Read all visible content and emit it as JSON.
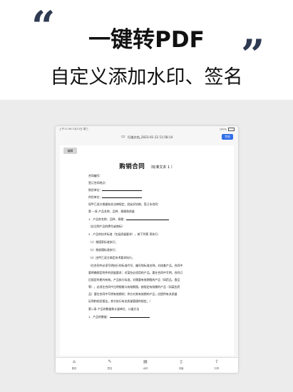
{
  "hero": {
    "quote_open": "“",
    "quote_close": "”",
    "headline": "一键转PDF",
    "subhead": "自定义添加水印、签名"
  },
  "tablet": {
    "status_time": "上午11:56  1月12日 周三",
    "status_battery": "100%",
    "doc_title": "扫描文档_2022-01-12 11:58:14",
    "done_label": "完成"
  },
  "paper": {
    "tag": "编辑",
    "title": "购销合同",
    "subtitle": "（标准文本 1 ）",
    "lines": [
      "合同编号：",
      "签订合同地点：",
      "购货单位：",
      "供货单位：",
      "现甲乙双方根据有关法律规定，经友好协商，签订本合同：",
      "第    一条    产品名称、品种、规格和质量",
      "1．产品的名称、品种、规格：",
      "（应注明产品的牌号或商标）",
      "2．产品的技术标准（包括质量要求），按下列第      项执行：",
      "（1）按国家标准执行；",
      "（2）按部颁标准执行；",
      "（3）由甲乙双方商定技术要求执行。",
      "（在合同中必须写明执行的标准代号、编号和标准名称。对成套产品，合同中",
      "要明确规定附件的质量要求；对某些必须用的产品，要在合同中写明，合同订",
      "后规定时期内有效。产品执行标准，对需要有效期限的产品（如药品、食品",
      "等），必须在合同中注明规格与有效期限，按规定有效期的产品（如某些药",
      "品）要在合同中写明有效期间；供方对其有效期的产品，应提供有关质量",
      "证明和检验报告，其它执行有关质量管理的规定。）",
      "第二条    产品的数量和计量单位、计量方法",
      "1．产品的数量："
    ]
  },
  "tabs": [
    {
      "icon": "home-icon",
      "label": "首页"
    },
    {
      "icon": "signature-icon",
      "label": "签名"
    },
    {
      "icon": "watermark-icon",
      "label": "水印"
    },
    {
      "icon": "bookmark-icon",
      "label": "页面"
    },
    {
      "icon": "share-icon",
      "label": "分享"
    }
  ]
}
